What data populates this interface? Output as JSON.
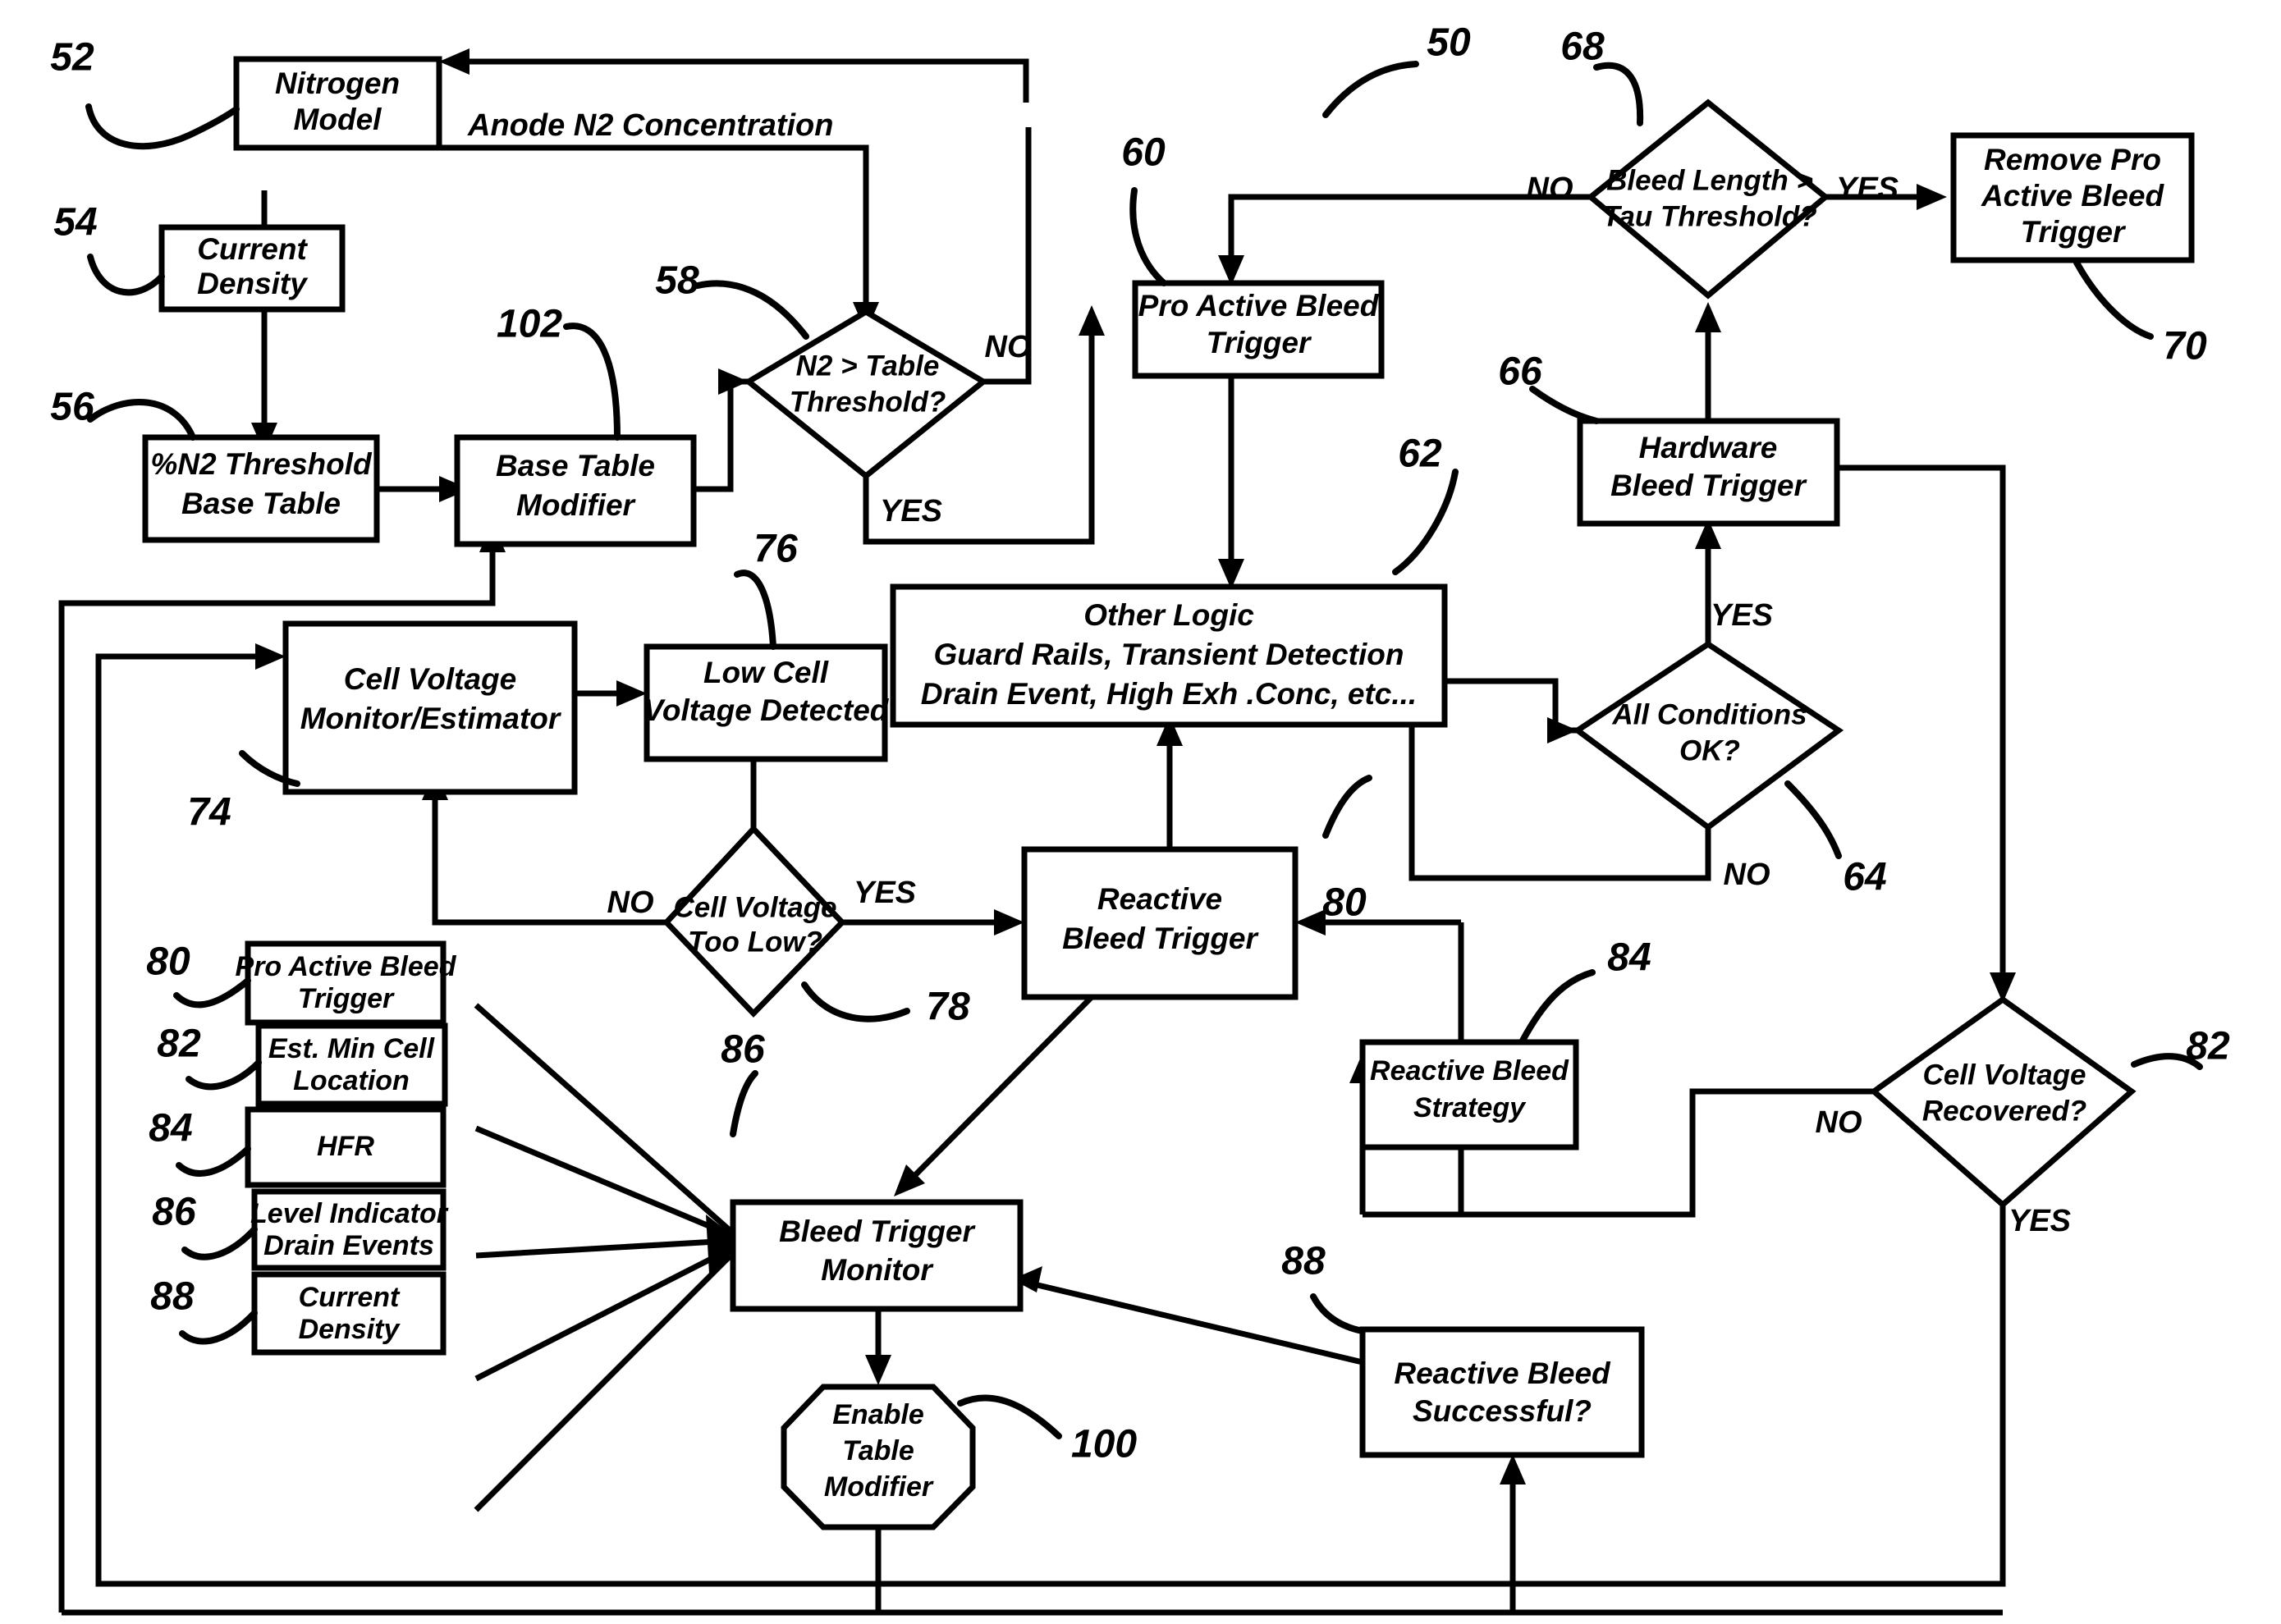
{
  "figure": {
    "title": "Anode Nitrogen Bleed Control Logic Flowchart",
    "main_reference": "50"
  },
  "nodes": {
    "nitrogen_model": {
      "label": "Nitrogen Model",
      "lines": [
        "Nitrogen",
        "Model"
      ],
      "ref": "52",
      "shape": "rect"
    },
    "current_density_top": {
      "label": "Current Density",
      "lines": [
        "Current",
        "Density"
      ],
      "ref": "54",
      "shape": "rect"
    },
    "n2_threshold_base_table": {
      "label": "%N2 Threshold Base Table",
      "lines": [
        "%N2 Threshold",
        "Base Table"
      ],
      "ref": "56",
      "shape": "rect"
    },
    "base_table_modifier": {
      "label": "Base Table Modifier",
      "lines": [
        "Base Table",
        "Modifier"
      ],
      "ref": "102",
      "shape": "rect"
    },
    "n2_gt_table_threshold": {
      "label": "N2 > Table Threshold?",
      "lines": [
        "N2 > Table",
        "Threshold?"
      ],
      "ref": "58",
      "shape": "diamond"
    },
    "pro_active_bleed_trigger": {
      "label": "Pro Active Bleed Trigger",
      "lines": [
        "Pro Active Bleed",
        "Trigger"
      ],
      "ref": "60",
      "shape": "rect"
    },
    "bleed_length_gt_tau": {
      "label": "Bleed Length > Tau Threshold?",
      "lines": [
        "Bleed Length >",
        "Tau Threshold?"
      ],
      "ref": "68",
      "shape": "diamond"
    },
    "remove_pro_active_bleed_trigger": {
      "label": "Remove Pro Active Bleed Trigger",
      "lines": [
        "Remove Pro",
        "Active Bleed",
        "Trigger"
      ],
      "ref": "70",
      "shape": "rect"
    },
    "hardware_bleed_trigger": {
      "label": "Hardware Bleed Trigger",
      "lines": [
        "Hardware",
        "Bleed Trigger"
      ],
      "ref": "66",
      "shape": "rect"
    },
    "all_conditions_ok": {
      "label": "All Conditions OK?",
      "lines": [
        "All Conditions",
        "OK?"
      ],
      "ref": "64",
      "shape": "diamond"
    },
    "other_logic": {
      "label": "Other Logic",
      "lines": [
        "Other Logic",
        "Guard Rails, Transient Detection",
        "Drain Event, High Exh .Conc, etc..."
      ],
      "ref": "62",
      "shape": "rect"
    },
    "cell_voltage_monitor": {
      "label": "Cell Voltage Monitor/Estimator",
      "lines": [
        "Cell Voltage",
        "Monitor/Estimator"
      ],
      "ref": "74",
      "shape": "rect"
    },
    "low_cell_voltage_detected": {
      "label": "Low Cell Voltage Detected",
      "lines": [
        "Low Cell",
        "Voltage Detected"
      ],
      "ref": "76",
      "shape": "rect"
    },
    "cell_voltage_too_low": {
      "label": "Cell Voltage Too Low?",
      "lines": [
        "Cell Voltage",
        "Too Low?"
      ],
      "ref": "78",
      "shape": "diamond"
    },
    "reactive_bleed_trigger": {
      "label": "Reactive Bleed Trigger",
      "lines": [
        "Reactive",
        "Bleed Trigger"
      ],
      "ref": "80",
      "shape": "rect"
    },
    "reactive_bleed_strategy": {
      "label": "Reactive Bleed Strategy",
      "lines": [
        "Reactive Bleed",
        "Strategy"
      ],
      "ref": "84",
      "shape": "rect"
    },
    "cell_voltage_recovered": {
      "label": "Cell Voltage Recovered?",
      "lines": [
        "Cell Voltage",
        "Recovered?"
      ],
      "ref": "82",
      "shape": "diamond"
    },
    "reactive_bleed_successful": {
      "label": "Reactive Bleed Successful?",
      "lines": [
        "Reactive Bleed",
        "Successful?"
      ],
      "ref": "88",
      "shape": "rect"
    },
    "bleed_trigger_monitor": {
      "label": "Bleed Trigger Monitor",
      "lines": [
        "Bleed Trigger",
        "Monitor"
      ],
      "ref": "86",
      "shape": "rect"
    },
    "enable_table_modifier": {
      "label": "Enable Table Modifier",
      "lines": [
        "Enable",
        "Table",
        "Modifier"
      ],
      "ref": "100",
      "shape": "octagon"
    },
    "input_pro_active_bleed_trigger": {
      "label": "Pro Active Bleed Trigger",
      "lines": [
        "Pro Active Bleed",
        "Trigger"
      ],
      "ref": "80",
      "shape": "rect"
    },
    "input_est_min_cell_location": {
      "label": "Est. Min Cell Location",
      "lines": [
        "Est. Min Cell",
        "Location"
      ],
      "ref": "82",
      "shape": "rect"
    },
    "input_hfr": {
      "label": "HFR",
      "lines": [
        "HFR"
      ],
      "ref": "84",
      "shape": "rect"
    },
    "input_level_indicator_drain_events": {
      "label": "Level Indicator Drain Events",
      "lines": [
        "Level Indicator",
        "Drain Events"
      ],
      "ref": "86",
      "shape": "rect"
    },
    "input_current_density": {
      "label": "Current Density",
      "lines": [
        "Current",
        "Density"
      ],
      "ref": "88",
      "shape": "rect"
    }
  },
  "edge_labels": {
    "anode_n2_concentration": "Anode N2 Concentration",
    "n2_threshold_no": "NO",
    "n2_threshold_yes": "YES",
    "bleed_length_no": "NO",
    "bleed_length_yes": "YES",
    "all_conditions_yes": "YES",
    "all_conditions_no": "NO",
    "cell_voltage_too_low_no": "NO",
    "cell_voltage_too_low_yes": "YES",
    "cell_voltage_recovered_no": "NO",
    "cell_voltage_recovered_yes": "YES"
  },
  "reference_numerals": [
    {
      "id": "50",
      "value": "50"
    },
    {
      "id": "52",
      "value": "52"
    },
    {
      "id": "54",
      "value": "54"
    },
    {
      "id": "56",
      "value": "56"
    },
    {
      "id": "58",
      "value": "58"
    },
    {
      "id": "60",
      "value": "60"
    },
    {
      "id": "62",
      "value": "62"
    },
    {
      "id": "64",
      "value": "64"
    },
    {
      "id": "66",
      "value": "66"
    },
    {
      "id": "68",
      "value": "68"
    },
    {
      "id": "70",
      "value": "70"
    },
    {
      "id": "74",
      "value": "74"
    },
    {
      "id": "76",
      "value": "76"
    },
    {
      "id": "78",
      "value": "78"
    },
    {
      "id": "80a",
      "value": "80"
    },
    {
      "id": "80b",
      "value": "80"
    },
    {
      "id": "82a",
      "value": "82"
    },
    {
      "id": "82b",
      "value": "82"
    },
    {
      "id": "84a",
      "value": "84"
    },
    {
      "id": "84b",
      "value": "84"
    },
    {
      "id": "86a",
      "value": "86"
    },
    {
      "id": "86b",
      "value": "86"
    },
    {
      "id": "88a",
      "value": "88"
    },
    {
      "id": "88b",
      "value": "88"
    },
    {
      "id": "100",
      "value": "100"
    },
    {
      "id": "102",
      "value": "102"
    }
  ],
  "colors": {
    "line": "#000000",
    "fill": "#ffffff",
    "background": "#ffffff"
  }
}
